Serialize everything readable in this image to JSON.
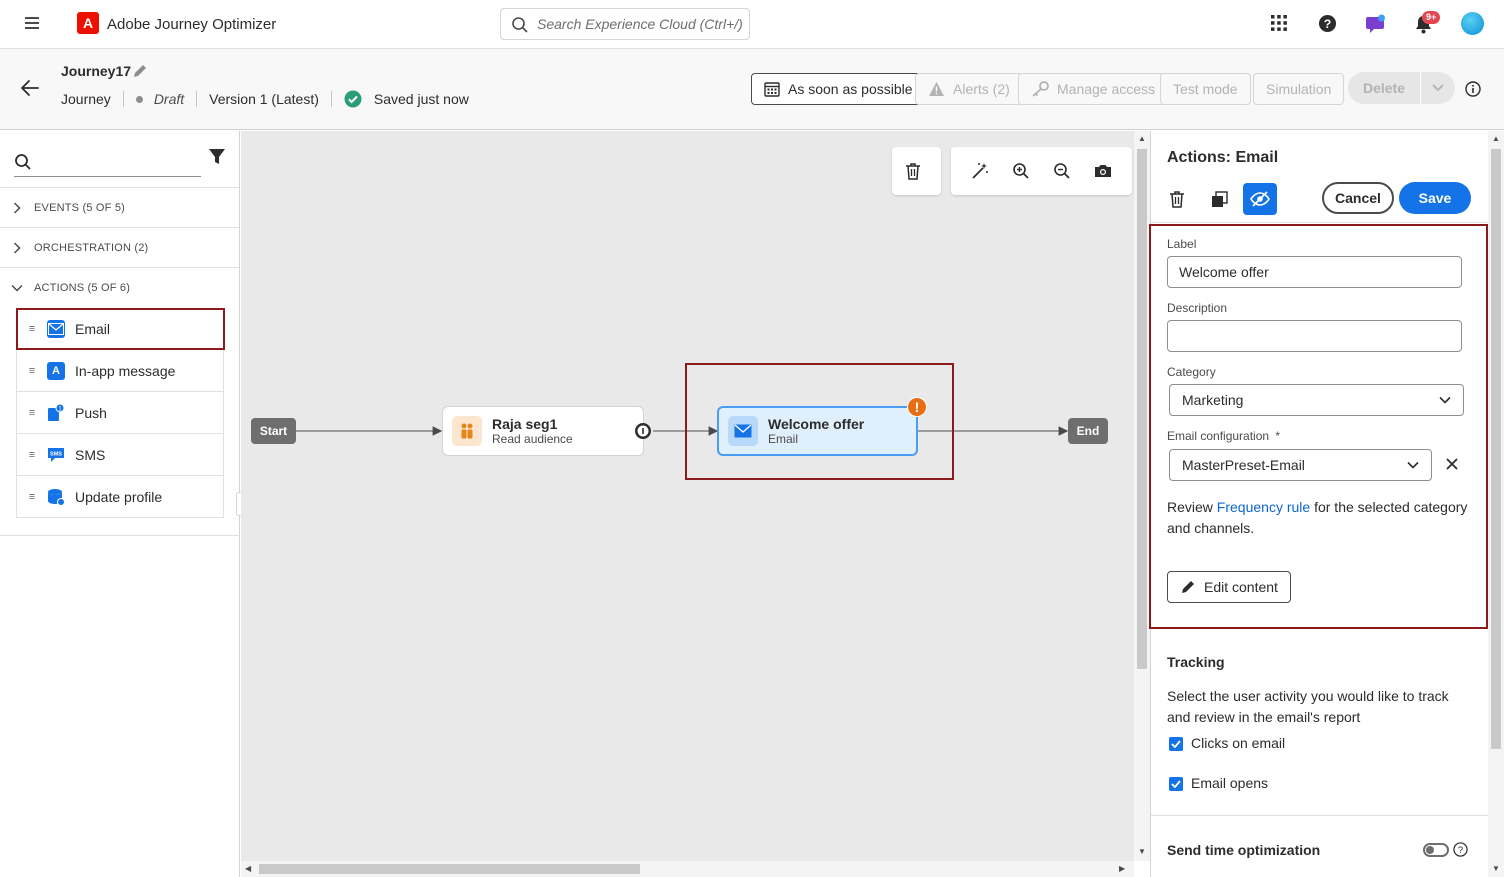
{
  "app": {
    "title": "Adobe Journey Optimizer",
    "logo_letter": "A",
    "search_placeholder": "Search Experience Cloud (Ctrl+/)",
    "notifications_badge": "9+",
    "icons": [
      "menu-icon",
      "search-icon",
      "apps-grid-icon",
      "help-icon",
      "chat-icon",
      "bell-icon",
      "avatar"
    ]
  },
  "journey": {
    "name": "Journey17",
    "type": "Journey",
    "status": "Draft",
    "version": "Version 1 (Latest)",
    "save_status": "Saved just now",
    "buttons": {
      "schedule": "As soon as possible",
      "alerts": "Alerts (2)",
      "manage_access": "Manage access",
      "test_mode": "Test mode",
      "simulation": "Simulation",
      "delete": "Delete"
    }
  },
  "palette": {
    "categories": [
      {
        "label": "EVENTS (5 OF 5)",
        "expanded": false
      },
      {
        "label": "ORCHESTRATION (2)",
        "expanded": false
      },
      {
        "label": "ACTIONS (5 OF 6)",
        "expanded": true
      }
    ],
    "actions": [
      {
        "label": "Email",
        "icon": "email-icon",
        "highlighted": true
      },
      {
        "label": "In-app message",
        "icon": "in-app-icon"
      },
      {
        "label": "Push",
        "icon": "push-icon"
      },
      {
        "label": "SMS",
        "icon": "sms-icon"
      },
      {
        "label": "Update profile",
        "icon": "update-profile-icon"
      }
    ]
  },
  "canvas": {
    "start_label": "Start",
    "end_label": "End",
    "nodes": [
      {
        "title": "Raja seg1",
        "subtitle": "Read audience",
        "icon": "audience-icon"
      },
      {
        "title": "Welcome offer",
        "subtitle": "Email",
        "icon": "email-icon",
        "selected": true,
        "warning": "!"
      }
    ],
    "tools": [
      "delete-icon",
      "auto-arrange-icon",
      "zoom-in-icon",
      "zoom-out-icon",
      "screenshot-icon"
    ]
  },
  "properties": {
    "title": "Actions: Email",
    "cancel_label": "Cancel",
    "save_label": "Save",
    "label_field": {
      "label": "Label",
      "value": "Welcome offer"
    },
    "description_field": {
      "label": "Description",
      "value": ""
    },
    "category_field": {
      "label": "Category",
      "value": "Marketing"
    },
    "email_config_field": {
      "label": "Email configuration",
      "required_mark": "*",
      "value": "MasterPreset-Email"
    },
    "review_text_before": "Review ",
    "review_link": "Frequency rule",
    "review_text_after": " for the selected category and channels.",
    "edit_content_label": "Edit content",
    "tracking": {
      "title": "Tracking",
      "description": "Select the user activity you would like to track and review in the email's report",
      "options": [
        {
          "label": "Clicks on email",
          "checked": true
        },
        {
          "label": "Email opens",
          "checked": true
        }
      ]
    },
    "send_time_optimization": {
      "title": "Send time optimization",
      "enabled": false
    }
  },
  "colors": {
    "accent": "#1473e6",
    "adobe_red": "#eb1000",
    "highlight_border": "#8b1a1a",
    "warning": "#e86e15",
    "success": "#2d9d78"
  }
}
